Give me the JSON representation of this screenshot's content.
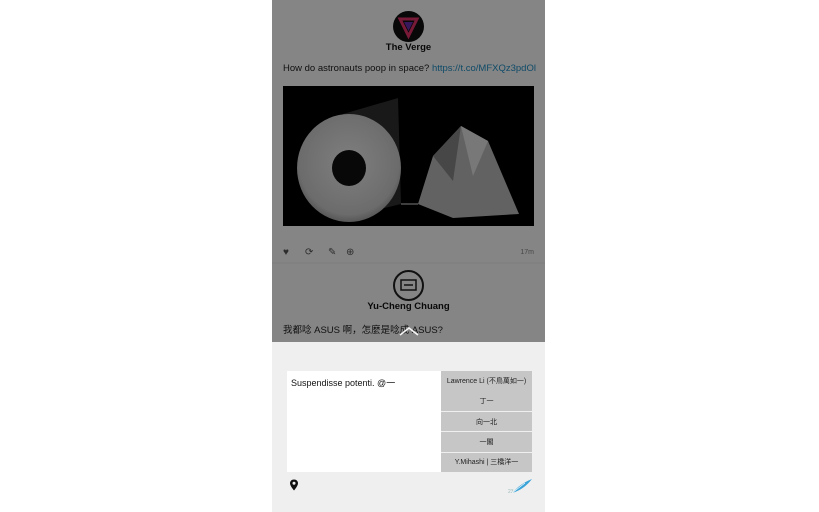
{
  "feed": {
    "tweets": [
      {
        "author": "The Verge",
        "text": "How do astronauts poop in space? ",
        "link": "https://t.co/MFXQz3pdOl",
        "time": "17m",
        "media_desc_icon": "toilet-paper-image"
      },
      {
        "author": "Yu-Cheng Chuang",
        "text": "我都唸 ASUS 啊，怎麼是唸成 ASUS?"
      }
    ]
  },
  "compose": {
    "text": "Suspendisse potenti. @一",
    "suggestions": [
      "Lawrence Li (不鳥萬如一)",
      "丁一",
      "向一北",
      "一閣",
      "Y.Mihashi | 三橋洋一"
    ],
    "char_count": "23"
  },
  "colors": {
    "link": "#1e90c8",
    "suggestion_bg": "#c6c6c6",
    "accent_feather": "#3aa3d8"
  }
}
